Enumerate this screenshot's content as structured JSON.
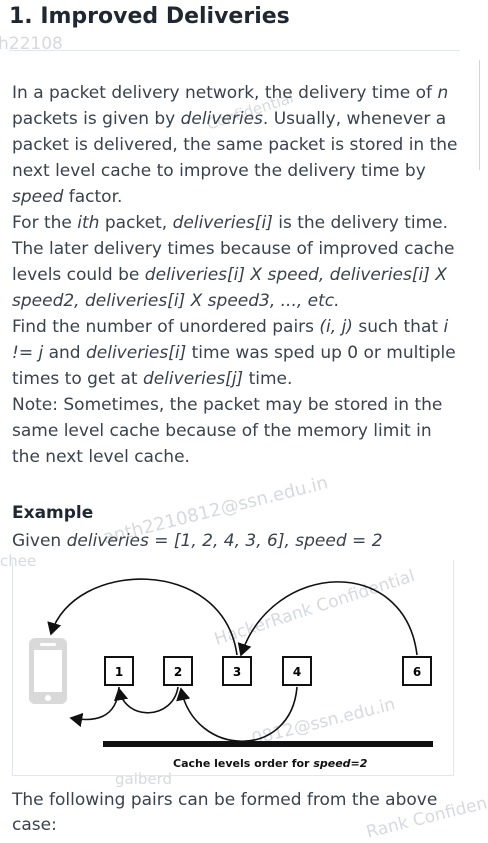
{
  "problem": {
    "title": "1. Improved Deliveries",
    "p1": {
      "a": "In a packet delivery network, the delivery time of ",
      "n": "n",
      "b": " packets is given by ",
      "deliveries": "deliveries",
      "c": ". Usually, whenever a packet is delivered, the same packet is stored in the next level cache to improve the delivery time by ",
      "speed": "speed",
      "d": " factor."
    },
    "p2": {
      "a": "For the ",
      "ith": "ith",
      "b": " packet, ",
      "deliveries_i": "deliveries[i]",
      "c": " is the delivery time. The later delivery times because of improved cache levels could be ",
      "seq": "deliveries[i] X speed, deliveries[i] X speed2, deliveries[i] X speed3, ..., etc."
    },
    "p3": {
      "a": "Find the number of unordered pairs ",
      "ij": "(i, j)",
      "b": " such that ",
      "ineq": "i != j",
      "c": " and ",
      "deliveries_i": "deliveries[i]",
      "d": "  time was sped up 0 or multiple times to get at ",
      "deliveries_j": "deliveries[j]",
      "e": " time."
    },
    "note": "Note: Sometimes, the packet may be stored in the same level cache because of the memory limit in the next level cache.",
    "example_heading": "Example",
    "given_prefix": "Given ",
    "given_expr": "deliveries = [1, 2, 4, 3, 6], speed = 2",
    "figure": {
      "boxes": [
        "1",
        "2",
        "3",
        "4",
        "6"
      ],
      "caption_prefix": "Cache levels order for ",
      "caption_speed": "speed=2",
      "arrow_color": "#111111",
      "device_color": "#d9d9d9"
    },
    "following": "The following pairs can be formed from the above case:"
  },
  "watermarks": {
    "w1": "h22108",
    "w2": "Confidential",
    "w3": "HackerRank Confidential",
    "w4": "anth2210812@ssn.edu.in",
    "w5": "0812@ssn.edu.in",
    "w6": "Rank Confiden",
    "w7": "chee",
    "w8": "galberd"
  }
}
